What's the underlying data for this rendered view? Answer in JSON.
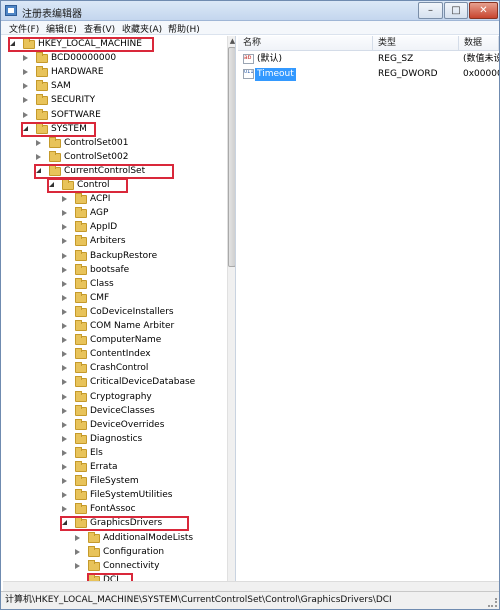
{
  "window": {
    "title": "注册表编辑器",
    "minimize_glyph": "–",
    "maximize_glyph": "□",
    "close_glyph": "✕"
  },
  "menu": {
    "items": [
      "文件(F)",
      "编辑(E)",
      "查看(V)",
      "收藏夹(A)",
      "帮助(H)"
    ]
  },
  "tree": {
    "rows": [
      {
        "label": "HKEY_LOCAL_MACHINE",
        "level": 0,
        "expanded": true,
        "highlighted": true
      },
      {
        "label": "BCD00000000",
        "level": 1,
        "expanded": false,
        "highlighted": false
      },
      {
        "label": "HARDWARE",
        "level": 1,
        "expanded": false,
        "highlighted": false
      },
      {
        "label": "SAM",
        "level": 1,
        "expanded": false,
        "highlighted": false
      },
      {
        "label": "SECURITY",
        "level": 1,
        "expanded": false,
        "highlighted": false
      },
      {
        "label": "SOFTWARE",
        "level": 1,
        "expanded": false,
        "highlighted": false
      },
      {
        "label": "SYSTEM",
        "level": 1,
        "expanded": true,
        "highlighted": true
      },
      {
        "label": "ControlSet001",
        "level": 2,
        "expanded": false,
        "highlighted": false
      },
      {
        "label": "ControlSet002",
        "level": 2,
        "expanded": false,
        "highlighted": false
      },
      {
        "label": "CurrentControlSet",
        "level": 2,
        "expanded": true,
        "highlighted": true
      },
      {
        "label": "Control",
        "level": 3,
        "expanded": true,
        "highlighted": true
      },
      {
        "label": "ACPI",
        "level": 4,
        "expanded": false,
        "highlighted": false
      },
      {
        "label": "AGP",
        "level": 4,
        "expanded": false,
        "highlighted": false
      },
      {
        "label": "AppID",
        "level": 4,
        "expanded": false,
        "highlighted": false
      },
      {
        "label": "Arbiters",
        "level": 4,
        "expanded": false,
        "highlighted": false
      },
      {
        "label": "BackupRestore",
        "level": 4,
        "expanded": false,
        "highlighted": false
      },
      {
        "label": "bootsafe",
        "level": 4,
        "expanded": false,
        "highlighted": false
      },
      {
        "label": "Class",
        "level": 4,
        "expanded": false,
        "highlighted": false
      },
      {
        "label": "CMF",
        "level": 4,
        "expanded": false,
        "highlighted": false
      },
      {
        "label": "CoDeviceInstallers",
        "level": 4,
        "expanded": false,
        "highlighted": false
      },
      {
        "label": "COM Name Arbiter",
        "level": 4,
        "expanded": false,
        "highlighted": false
      },
      {
        "label": "ComputerName",
        "level": 4,
        "expanded": false,
        "highlighted": false
      },
      {
        "label": "ContentIndex",
        "level": 4,
        "expanded": false,
        "highlighted": false
      },
      {
        "label": "CrashControl",
        "level": 4,
        "expanded": false,
        "highlighted": false
      },
      {
        "label": "CriticalDeviceDatabase",
        "level": 4,
        "expanded": false,
        "highlighted": false
      },
      {
        "label": "Cryptography",
        "level": 4,
        "expanded": false,
        "highlighted": false
      },
      {
        "label": "DeviceClasses",
        "level": 4,
        "expanded": false,
        "highlighted": false
      },
      {
        "label": "DeviceOverrides",
        "level": 4,
        "expanded": false,
        "highlighted": false
      },
      {
        "label": "Diagnostics",
        "level": 4,
        "expanded": false,
        "highlighted": false
      },
      {
        "label": "Els",
        "level": 4,
        "expanded": false,
        "highlighted": false
      },
      {
        "label": "Errata",
        "level": 4,
        "expanded": false,
        "highlighted": false
      },
      {
        "label": "FileSystem",
        "level": 4,
        "expanded": false,
        "highlighted": false
      },
      {
        "label": "FileSystemUtilities",
        "level": 4,
        "expanded": false,
        "highlighted": false
      },
      {
        "label": "FontAssoc",
        "level": 4,
        "expanded": false,
        "highlighted": false
      },
      {
        "label": "GraphicsDrivers",
        "level": 4,
        "expanded": true,
        "highlighted": true
      },
      {
        "label": "AdditionalModeLists",
        "level": 5,
        "expanded": false,
        "highlighted": false
      },
      {
        "label": "Configuration",
        "level": 5,
        "expanded": false,
        "highlighted": false
      },
      {
        "label": "Connectivity",
        "level": 5,
        "expanded": false,
        "highlighted": false
      },
      {
        "label": "DCI",
        "level": 5,
        "expanded": null,
        "highlighted": true
      }
    ]
  },
  "values_table": {
    "headers": [
      "名称",
      "类型",
      "数据"
    ],
    "rows": [
      {
        "icon": "string-value-icon",
        "icon_text": "ab",
        "name": "(默认)",
        "type": "REG_SZ",
        "data": "(数值未设",
        "selected": false
      },
      {
        "icon": "dword-value-icon",
        "icon_text": "011",
        "name": "Timeout",
        "type": "REG_DWORD",
        "data": "0x00000",
        "selected": true
      }
    ]
  },
  "statusbar": {
    "path": "计算机\\HKEY_LOCAL_MACHINE\\SYSTEM\\CurrentControlSet\\Control\\GraphicsDrivers\\DCI"
  },
  "colors": {
    "highlight_border": "#d9283a",
    "selection": "#3399ff",
    "folder": "#e8c35a"
  }
}
